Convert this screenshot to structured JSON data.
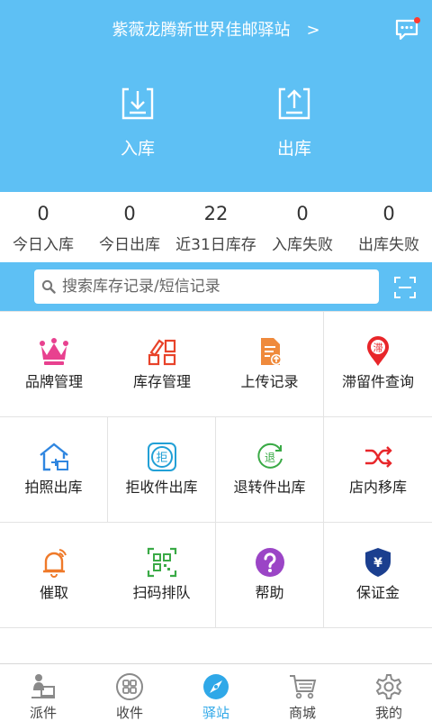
{
  "header": {
    "station_name": "紫薇龙腾新世界佳邮驿站",
    "chevron": ">",
    "message_icon": "message-icon",
    "colors": {
      "background": "#5ec0f4",
      "badge": "#ff3b30"
    }
  },
  "actions": [
    {
      "label": "入库",
      "icon": "inbound-icon"
    },
    {
      "label": "出库",
      "icon": "outbound-icon"
    }
  ],
  "stats": [
    {
      "value": "0",
      "label": "今日入库"
    },
    {
      "value": "0",
      "label": "今日出库"
    },
    {
      "value": "22",
      "label": "近31日库存"
    },
    {
      "value": "0",
      "label": "入库失败"
    },
    {
      "value": "0",
      "label": "出库失败"
    }
  ],
  "search": {
    "placeholder": "搜索库存记录/短信记录",
    "scan_icon": "scan-icon"
  },
  "grid": [
    {
      "label": "品牌管理",
      "icon": "crown-icon"
    },
    {
      "label": "库存管理",
      "icon": "inventory-icon"
    },
    {
      "label": "上传记录",
      "icon": "upload-record-icon"
    },
    {
      "label": "滞留件查询",
      "icon": "stranded-icon"
    },
    {
      "label": "拍照出库",
      "icon": "photo-out-icon"
    },
    {
      "label": "拒收件出库",
      "icon": "reject-icon"
    },
    {
      "label": "退转件出库",
      "icon": "return-icon"
    },
    {
      "label": "店内移库",
      "icon": "shuffle-icon"
    },
    {
      "label": "催取",
      "icon": "bell-icon"
    },
    {
      "label": "扫码排队",
      "icon": "qr-queue-icon"
    },
    {
      "label": "帮助",
      "icon": "help-icon"
    },
    {
      "label": "保证金",
      "icon": "deposit-shield-icon"
    }
  ],
  "tabs": [
    {
      "label": "派件",
      "icon": "courier-icon",
      "active": false
    },
    {
      "label": "收件",
      "icon": "grid-apps-icon",
      "active": false
    },
    {
      "label": "驿站",
      "icon": "compass-icon",
      "active": true
    },
    {
      "label": "商城",
      "icon": "cart-icon",
      "active": false
    },
    {
      "label": "我的",
      "icon": "gear-icon",
      "active": false
    }
  ]
}
